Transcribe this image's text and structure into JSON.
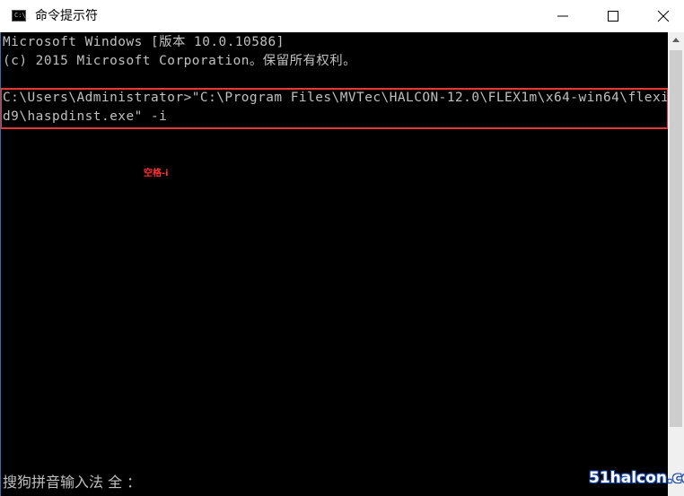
{
  "window": {
    "title": "命令提示符",
    "app_icon_glyph": "C:\\_",
    "buttons": {
      "minimize_icon": "minimize-icon",
      "maximize_icon": "maximize-icon",
      "close_icon": "close-icon"
    }
  },
  "console": {
    "lines": [
      "Microsoft Windows [版本 10.0.10586]",
      "(c) 2015 Microsoft Corporation。保留所有权利。",
      "",
      "C:\\Users\\Administrator>\"C:\\Program Files\\MVTec\\HALCON-12.0\\FLEX1m\\x64-win64\\flexi",
      "d9\\haspdinst.exe\" -i"
    ],
    "annotation": "空格-i",
    "ime_status": "搜狗拼音输入法 全 ："
  },
  "watermark": "51halcon.com",
  "colors": {
    "console_bg": "#000000",
    "console_text": "#c0c0c0",
    "highlight_border": "#e53935",
    "annotation_text": "#ff3030",
    "watermark_outline": "#1a4aa8"
  }
}
